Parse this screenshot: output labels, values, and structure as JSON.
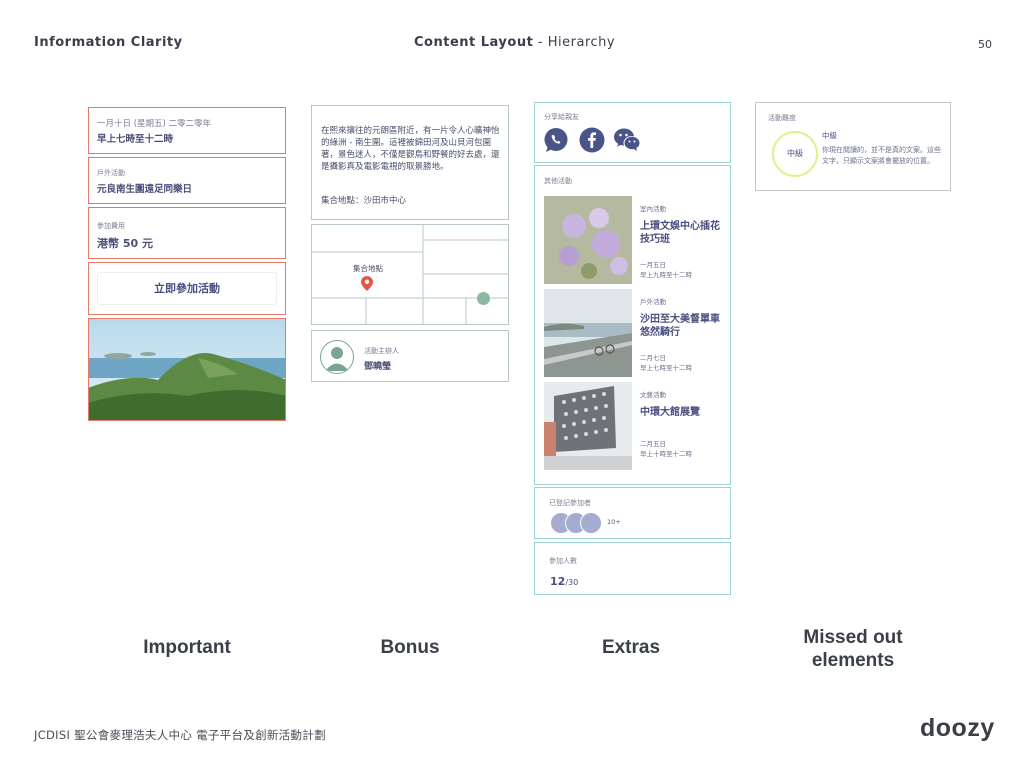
{
  "header": {
    "left_title": "Information Clarity",
    "center_bold": "Content Layout",
    "center_sep": " - ",
    "center_light": "Hierarchy",
    "page_number": "50"
  },
  "important": {
    "date_line": "一月十日 (星期五) 二零二零年",
    "time_line": "早上七時至十二時",
    "type_label": "戶外活動",
    "event_name": "元良南生圍遠足同樂日",
    "fee_label": "參加費用",
    "fee_value": "港幣 50 元",
    "join_button": "立即參加活動"
  },
  "bonus": {
    "description": "在熙來攘往的元朗區附近，有一片令人心曠神怡的綠洲 - 南生圍。這裡被錦田河及山貝河包圍著，景色迷人，不僅是觀鳥和野餐的好去處，還是攝影真及電影電視的取景勝地。",
    "meet_point": "集合地點：沙田市中心",
    "map_label": "集合地點",
    "host_label": "活動主辦人",
    "host_name": "鄧曉瑩"
  },
  "extras": {
    "share_label": "分享給親友",
    "other_label": "其他活動",
    "events": [
      {
        "tag": "室內活動",
        "title": "上環文娛中心插花技巧班",
        "date": "一月五日",
        "time": "早上九時至十二時"
      },
      {
        "tag": "戶外活動",
        "title": "沙田至大美督單車悠然騎行",
        "date": "二月七日",
        "time": "早上七時至十二時"
      },
      {
        "tag": "文藝活動",
        "title": "中環大館展覽",
        "date": "二月五日",
        "time": "早上十時至十二時"
      }
    ],
    "registered_label": "已登記參加者",
    "registered_count": "10+",
    "participants_label": "參加人數",
    "participants_current": "12",
    "participants_total": "/30"
  },
  "missed": {
    "difficulty_label": "活動難度",
    "level_circle": "中級",
    "level_title": "中級",
    "level_desc": "你現在閱讀的，並不是真的文案。這些文字，只顯示文案將會擺放的位置。",
    "accent_color": "#e3f08a"
  },
  "categories": {
    "important": "Important",
    "bonus": "Bonus",
    "extras": "Extras",
    "missed": "Missed out elements"
  },
  "footer": {
    "left": "JCDISI 聖公會麥理浩夫人中心 電子平台及創新活動計劃",
    "logo": "doozy"
  },
  "icons": [
    "whatsapp-icon",
    "facebook-icon",
    "wechat-icon",
    "map-pin-icon",
    "user-avatar-icon"
  ]
}
